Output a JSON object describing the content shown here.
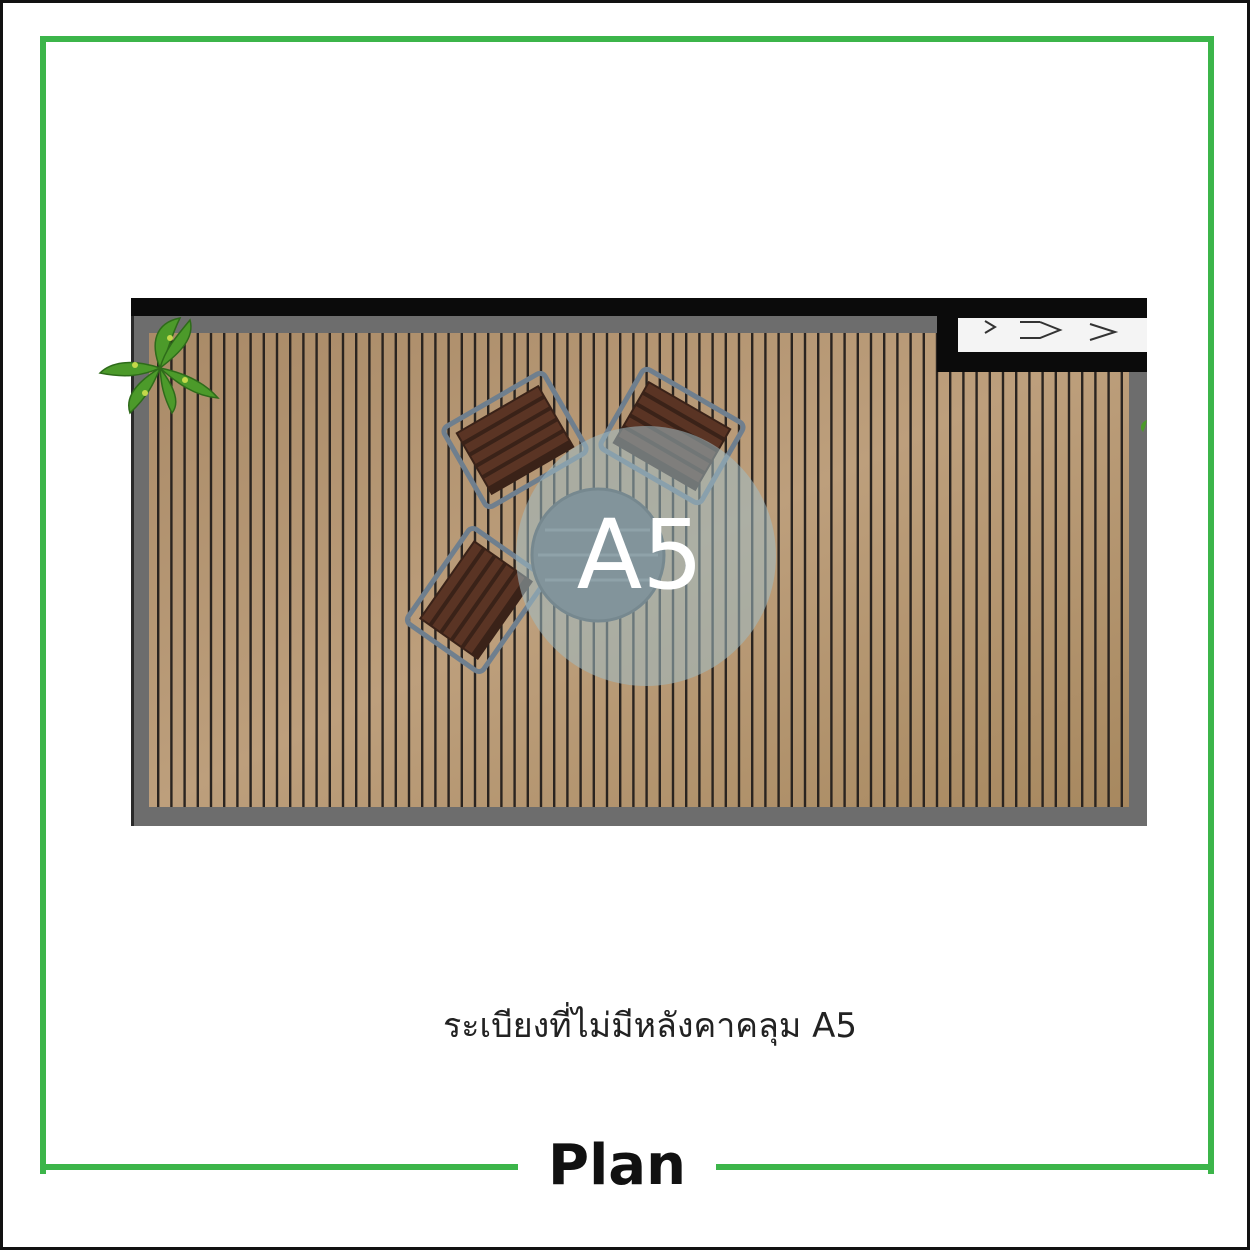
{
  "drawing": {
    "area_label": "A5",
    "caption": "ระเบียงที่ไม่มีหลังคาคลุม A5",
    "view_label": "Plan"
  },
  "colors": {
    "frame_green": "#3cb54a",
    "outer_border": "#111111",
    "deck_wood": "#b39472",
    "deck_gap": "#2a2420",
    "concrete_edge": "#6d6d6d",
    "wall_black": "#0b0b0b",
    "chair_slat": "#4a2a1c",
    "chair_frame": "#6f7f8e",
    "badge_fill": "#9fbcc4",
    "plant_green": "#4c9a2a"
  },
  "icons": {
    "plant": "plant-icon",
    "chair": "chair-icon",
    "table": "table-icon",
    "stair": "stair-arrows-icon"
  }
}
